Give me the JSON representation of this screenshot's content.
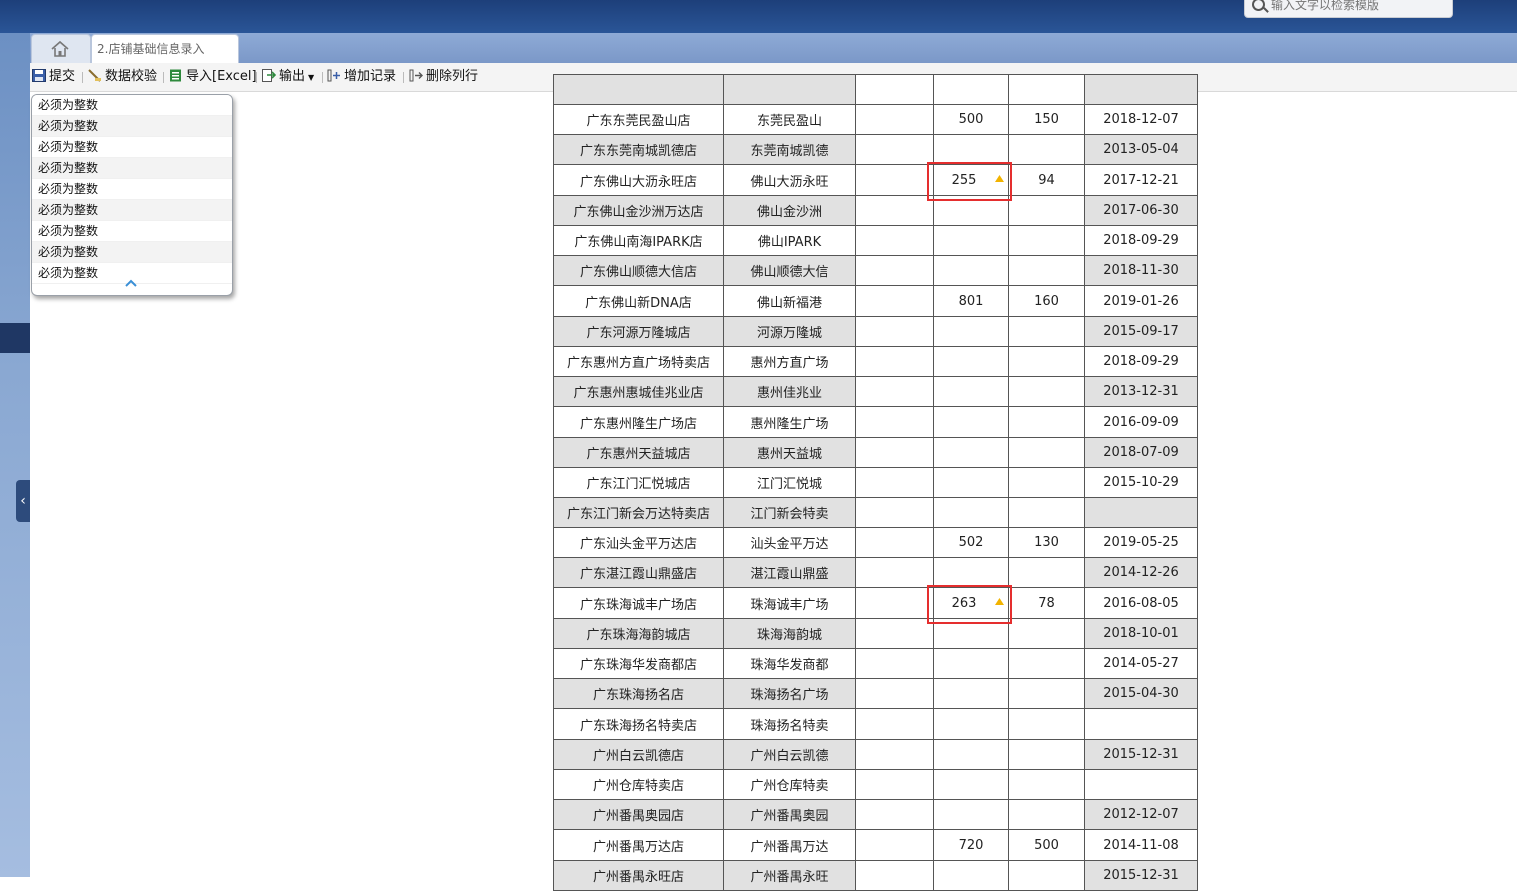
{
  "search": {
    "placeholder": "输入文字以检索模版"
  },
  "tabs": {
    "active_tab": "2.店铺基础信息录入"
  },
  "toolbar": {
    "submit": "提交",
    "validate": "数据校验",
    "import": "导入[Excel]",
    "export": "输出",
    "add_record": "增加记录",
    "delete_column": "删除列行"
  },
  "popup": {
    "messages": [
      "必须为整数",
      "必须为整数",
      "必须为整数",
      "必须为整数",
      "必须为整数",
      "必须为整数",
      "必须为整数",
      "必须为整数",
      "必须为整数"
    ]
  },
  "table": {
    "rows": [
      {
        "store": "",
        "short": "",
        "c3": "",
        "c4": "",
        "c5": "",
        "date": "",
        "warn": false,
        "highlight": false
      },
      {
        "store": "广东东莞民盈山店",
        "short": "东莞民盈山",
        "c3": "",
        "c4": "500",
        "c5": "150",
        "date": "2018-12-07",
        "warn": false,
        "highlight": false
      },
      {
        "store": "广东东莞南城凯德店",
        "short": "东莞南城凯德",
        "c3": "",
        "c4": "",
        "c5": "",
        "date": "2013-05-04",
        "warn": false,
        "highlight": false
      },
      {
        "store": "广东佛山大沥永旺店",
        "short": "佛山大沥永旺",
        "c3": "",
        "c4": "255",
        "c5": "94",
        "date": "2017-12-21",
        "warn": true,
        "highlight": true
      },
      {
        "store": "广东佛山金沙洲万达店",
        "short": "佛山金沙洲",
        "c3": "",
        "c4": "",
        "c5": "",
        "date": "2017-06-30",
        "warn": false,
        "highlight": false
      },
      {
        "store": "广东佛山南海IPARK店",
        "short": "佛山IPARK",
        "c3": "",
        "c4": "",
        "c5": "",
        "date": "2018-09-29",
        "warn": false,
        "highlight": false
      },
      {
        "store": "广东佛山顺德大信店",
        "short": "佛山顺德大信",
        "c3": "",
        "c4": "",
        "c5": "",
        "date": "2018-11-30",
        "warn": false,
        "highlight": false
      },
      {
        "store": "广东佛山新DNA店",
        "short": "佛山新福港",
        "c3": "",
        "c4": "801",
        "c5": "160",
        "date": "2019-01-26",
        "warn": false,
        "highlight": false
      },
      {
        "store": "广东河源万隆城店",
        "short": "河源万隆城",
        "c3": "",
        "c4": "",
        "c5": "",
        "date": "2015-09-17",
        "warn": false,
        "highlight": false
      },
      {
        "store": "广东惠州方直广场特卖店",
        "short": "惠州方直广场",
        "c3": "",
        "c4": "",
        "c5": "",
        "date": "2018-09-29",
        "warn": false,
        "highlight": false
      },
      {
        "store": "广东惠州惠城佳兆业店",
        "short": "惠州佳兆业",
        "c3": "",
        "c4": "",
        "c5": "",
        "date": "2013-12-31",
        "warn": false,
        "highlight": false
      },
      {
        "store": "广东惠州隆生广场店",
        "short": "惠州隆生广场",
        "c3": "",
        "c4": "",
        "c5": "",
        "date": "2016-09-09",
        "warn": false,
        "highlight": false
      },
      {
        "store": "广东惠州天益城店",
        "short": "惠州天益城",
        "c3": "",
        "c4": "",
        "c5": "",
        "date": "2018-07-09",
        "warn": false,
        "highlight": false
      },
      {
        "store": "广东江门汇悦城店",
        "short": "江门汇悦城",
        "c3": "",
        "c4": "",
        "c5": "",
        "date": "2015-10-29",
        "warn": false,
        "highlight": false
      },
      {
        "store": "广东江门新会万达特卖店",
        "short": "江门新会特卖",
        "c3": "",
        "c4": "",
        "c5": "",
        "date": "",
        "warn": false,
        "highlight": false
      },
      {
        "store": "广东汕头金平万达店",
        "short": "汕头金平万达",
        "c3": "",
        "c4": "502",
        "c5": "130",
        "date": "2019-05-25",
        "warn": false,
        "highlight": false
      },
      {
        "store": "广东湛江霞山鼎盛店",
        "short": "湛江霞山鼎盛",
        "c3": "",
        "c4": "",
        "c5": "",
        "date": "2014-12-26",
        "warn": false,
        "highlight": false
      },
      {
        "store": "广东珠海诚丰广场店",
        "short": "珠海诚丰广场",
        "c3": "",
        "c4": "263",
        "c5": "78",
        "date": "2016-08-05",
        "warn": true,
        "highlight": true
      },
      {
        "store": "广东珠海海韵城店",
        "short": "珠海海韵城",
        "c3": "",
        "c4": "",
        "c5": "",
        "date": "2018-10-01",
        "warn": false,
        "highlight": false
      },
      {
        "store": "广东珠海华发商都店",
        "short": "珠海华发商都",
        "c3": "",
        "c4": "",
        "c5": "",
        "date": "2014-05-27",
        "warn": false,
        "highlight": false
      },
      {
        "store": "广东珠海扬名店",
        "short": "珠海扬名广场",
        "c3": "",
        "c4": "",
        "c5": "",
        "date": "2015-04-30",
        "warn": false,
        "highlight": false
      },
      {
        "store": "广东珠海扬名特卖店",
        "short": "珠海扬名特卖",
        "c3": "",
        "c4": "",
        "c5": "",
        "date": "",
        "warn": false,
        "highlight": false
      },
      {
        "store": "广州白云凯德店",
        "short": "广州白云凯德",
        "c3": "",
        "c4": "",
        "c5": "",
        "date": "2015-12-31",
        "warn": false,
        "highlight": false
      },
      {
        "store": "广州仓库特卖店",
        "short": "广州仓库特卖",
        "c3": "",
        "c4": "",
        "c5": "",
        "date": "",
        "warn": false,
        "highlight": false
      },
      {
        "store": "广州番禺奥园店",
        "short": "广州番禺奥园",
        "c3": "",
        "c4": "",
        "c5": "",
        "date": "2012-12-07",
        "warn": false,
        "highlight": false
      },
      {
        "store": "广州番禺万达店",
        "short": "广州番禺万达",
        "c3": "",
        "c4": "720",
        "c5": "500",
        "date": "2014-11-08",
        "warn": false,
        "highlight": false
      },
      {
        "store": "广州番禺永旺店",
        "short": "广州番禺永旺",
        "c3": "",
        "c4": "",
        "c5": "",
        "date": "2015-12-31",
        "warn": false,
        "highlight": false
      }
    ]
  },
  "colors": {
    "highlight_border": "#e52e2e",
    "warn_icon": "#f2b300",
    "row_gray": "#e1e1e1"
  }
}
